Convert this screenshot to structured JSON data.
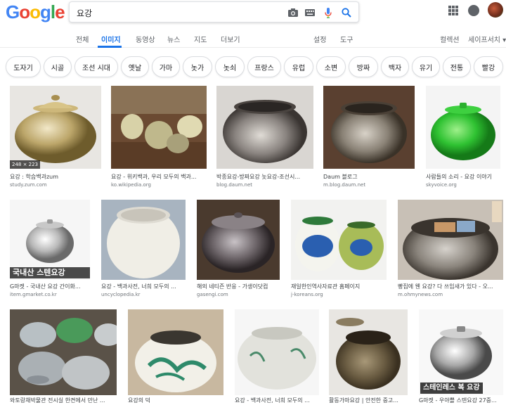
{
  "search": {
    "query": "요강"
  },
  "nav": {
    "tabs": [
      "전체",
      "이미지",
      "동영상",
      "뉴스",
      "지도",
      "더보기",
      "설정",
      "도구"
    ],
    "right": [
      "컬렉션",
      "세이프서치 ▾"
    ]
  },
  "chips": [
    "도자기",
    "시골",
    "조선 시대",
    "옛날",
    "가마",
    "놋가",
    "놋쇠",
    "프랑스",
    "유럽",
    "소변",
    "방짜",
    "백자",
    "유기",
    "전통",
    "빨강"
  ],
  "row1": [
    {
      "title": "요강 : 학습백과zum",
      "source": "study.zum.com",
      "dims": "248 × 223"
    },
    {
      "title": "요강 - 위키백과, 우리 모두의 백과...",
      "source": "ko.wikipedia.org"
    },
    {
      "title": "박종요강-방짜요강 놋요강-조선시...",
      "source": "blog.daum.net"
    },
    {
      "title": "Daum 블로그",
      "source": "m.blog.daum.net"
    },
    {
      "title": "사람들의 소리 - 요강 이야기",
      "source": "skyvoice.org"
    }
  ],
  "row2": [
    {
      "title": "G마켓 - 국내산 요강 간이화...",
      "source": "item.gmarket.co.kr",
      "overlay": "국내산 스텐요강"
    },
    {
      "title": "요강 - 백과사전, 너희 모두의 ...",
      "source": "uncyclopedia.kr"
    },
    {
      "title": "해외 네티즌 반응 - 가생이닷컴",
      "source": "gasengi.com"
    },
    {
      "title": "재일한인역사자료관 홈페이지",
      "source": "j-koreans.org"
    },
    {
      "title": "빵집에 웬 요강? 다 쓰임새가 있다 - 오...",
      "source": "m.ohmynews.com"
    }
  ],
  "row3": [
    {
      "title": "와토랑채박물관 전시실 한켠에서 만난 ..."
    },
    {
      "title": "요강의 덕"
    },
    {
      "title": "요강 - 백과사전, 너희 모두의 ..."
    },
    {
      "title": "활동가마요강 | 안전한 중고..."
    },
    {
      "title": "G마켓 - 우야쁠 스텐요강 27중...",
      "overlay": "스테인레스 복 요강"
    }
  ],
  "colors": {
    "accent": "#1a73e8",
    "blue": "#4285f4",
    "red": "#ea4335",
    "yellow": "#fbbc05",
    "green": "#34a853"
  }
}
